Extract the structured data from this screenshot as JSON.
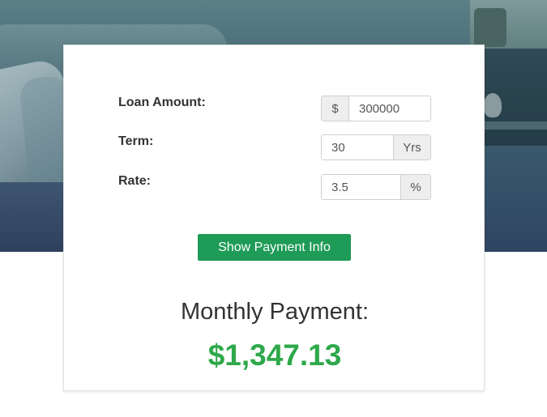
{
  "hero": {
    "image_description_icon": "living-room-photo"
  },
  "calculator": {
    "rows": [
      {
        "label": "Loan Amount:",
        "prefix": "$",
        "value": "300000",
        "suffix": ""
      },
      {
        "label": "Term:",
        "prefix": "",
        "value": "30",
        "suffix": "Yrs"
      },
      {
        "label": "Rate:",
        "prefix": "",
        "value": "3.5",
        "suffix": "%"
      }
    ],
    "button_label": "Show Payment Info",
    "result_label": "Monthly Payment:",
    "result_value": "$1,347.13"
  },
  "colors": {
    "button": "#1e9b57",
    "result_value": "#2ea84a",
    "label_text": "#333333"
  }
}
